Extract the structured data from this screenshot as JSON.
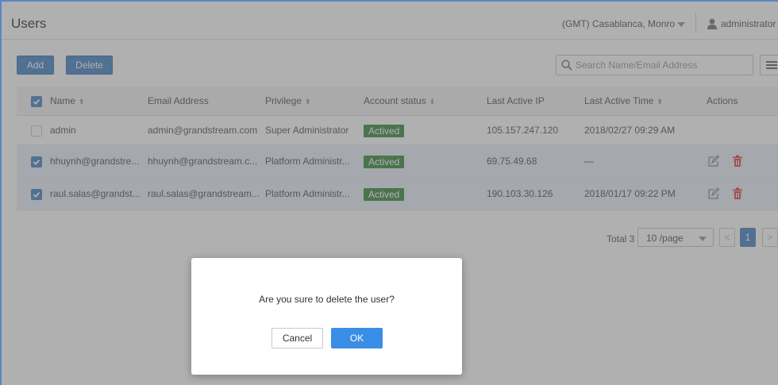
{
  "header": {
    "title": "Users",
    "timezone": "(GMT) Casablanca, Monro",
    "user": "administrator"
  },
  "toolbar": {
    "add_label": "Add",
    "delete_label": "Delete",
    "search_placeholder": "Search Name/Email Address"
  },
  "table": {
    "columns": {
      "name": "Name",
      "email": "Email Address",
      "privilege": "Privilege",
      "status": "Account status",
      "ip": "Last Active IP",
      "time": "Last Active Time",
      "actions": "Actions"
    },
    "header_checked": true,
    "rows": [
      {
        "checked": false,
        "name": "admin",
        "email": "admin@grandstream.com",
        "privilege": "Super Administrator",
        "status": "Actived",
        "ip": "105.157.247.120",
        "time": "2018/02/27 09:29 AM",
        "has_actions": false
      },
      {
        "checked": true,
        "name": "hhuynh@grandstre...",
        "email": "hhuynh@grandstream.c...",
        "privilege": "Platform Administr...",
        "status": "Actived",
        "ip": "69.75.49.68",
        "time": "—",
        "has_actions": true
      },
      {
        "checked": true,
        "name": "raul.salas@grandst...",
        "email": "raul.salas@grandstream...",
        "privilege": "Platform Administr...",
        "status": "Actived",
        "ip": "190.103.30.126",
        "time": "2018/01/17 09:22 PM",
        "has_actions": true
      }
    ]
  },
  "pagination": {
    "total": "Total 3",
    "page_size": "10 /page",
    "prev": "<",
    "current_page": "1",
    "next": ">"
  },
  "dialog": {
    "message": "Are you sure to delete the user?",
    "cancel_label": "Cancel",
    "ok_label": "OK"
  },
  "colors": {
    "primary": "#4a86c8",
    "status_badge": "#3e8d43",
    "delete_icon": "#e04b4b",
    "dialog_ok": "#3a8ee6"
  },
  "icons": {
    "search": "search-icon",
    "user": "user-icon",
    "menu": "menu-icon",
    "edit": "edit-icon",
    "delete": "trash-icon",
    "sort": "sort-icon",
    "check": "check-icon"
  }
}
